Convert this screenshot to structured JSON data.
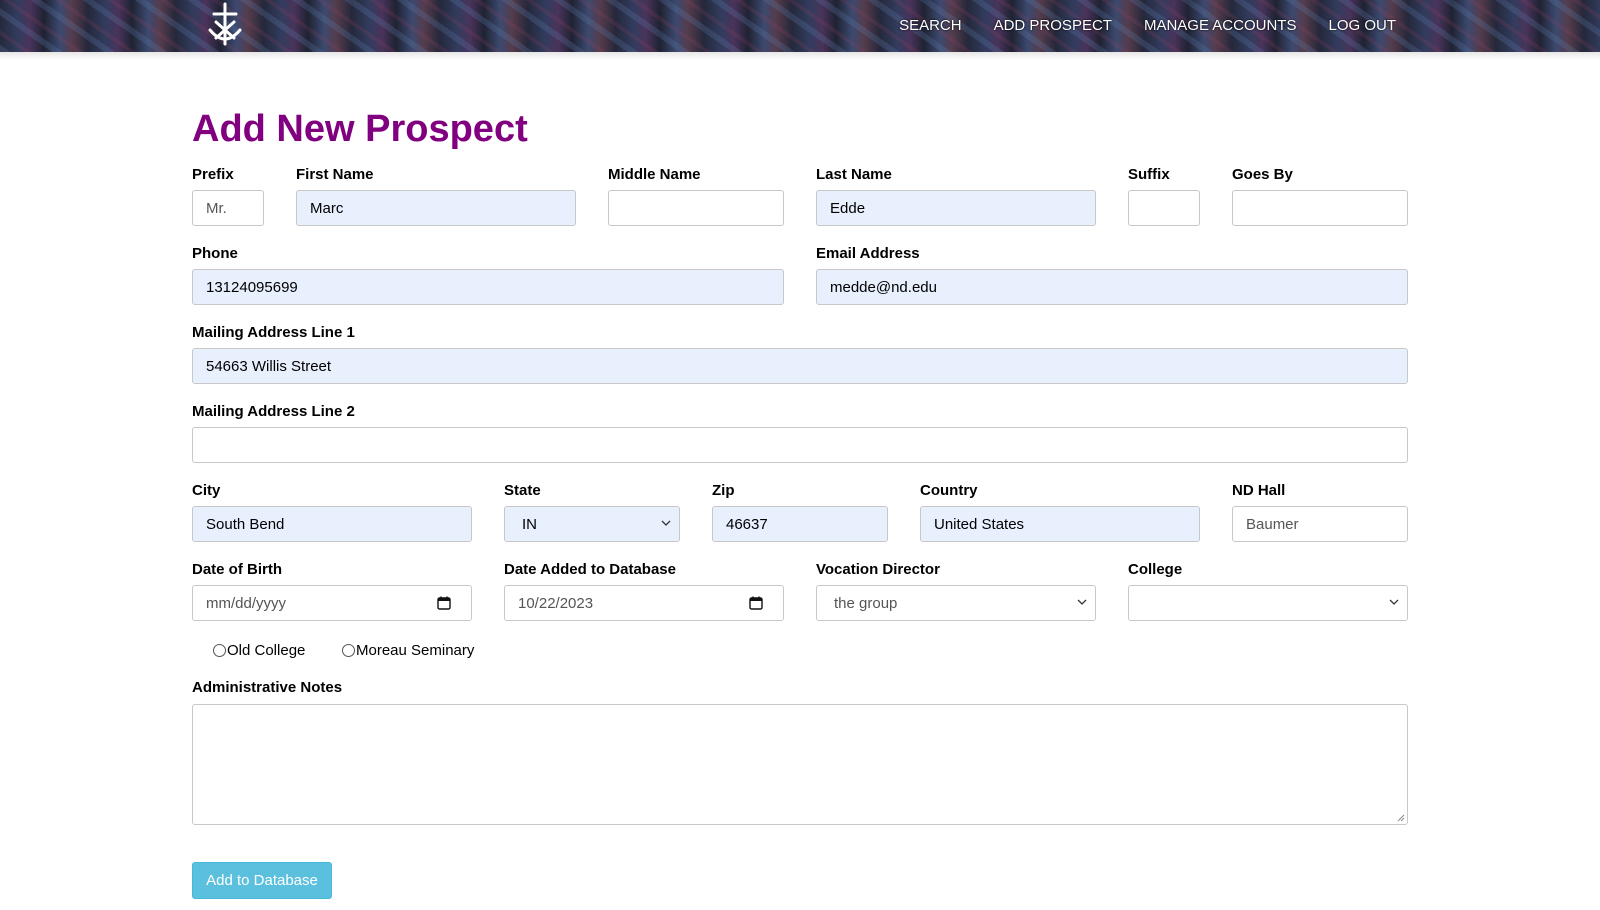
{
  "header": {
    "logo_icon": "cross-anchor-icon",
    "nav": [
      "SEARCH",
      "ADD PROSPECT",
      "MANAGE ACCOUNTS",
      "LOG OUT"
    ]
  },
  "page": {
    "title": "Add New Prospect",
    "title_color": "#800080"
  },
  "form": {
    "prefix": {
      "label": "Prefix",
      "value": "Mr."
    },
    "first_name": {
      "label": "First Name",
      "value": "Marc"
    },
    "middle_name": {
      "label": "Middle Name",
      "value": ""
    },
    "last_name": {
      "label": "Last Name",
      "value": "Edde"
    },
    "suffix": {
      "label": "Suffix",
      "value": ""
    },
    "goes_by": {
      "label": "Goes By",
      "value": ""
    },
    "phone": {
      "label": "Phone",
      "value": "13124095699"
    },
    "email": {
      "label": "Email Address",
      "value": "medde@nd.edu"
    },
    "address1": {
      "label": "Mailing Address Line 1",
      "value": "54663 Willis Street"
    },
    "address2": {
      "label": "Mailing Address Line 2",
      "value": ""
    },
    "city": {
      "label": "City",
      "value": "South Bend"
    },
    "state": {
      "label": "State",
      "value": "IN"
    },
    "zip": {
      "label": "Zip",
      "value": "46637"
    },
    "country": {
      "label": "Country",
      "value": "United States"
    },
    "nd_hall": {
      "label": "ND Hall",
      "value": "Baumer"
    },
    "dob": {
      "label": "Date of Birth",
      "value": "mm/dd/yyyy"
    },
    "date_added": {
      "label": "Date Added to Database",
      "value": "10/22/2023"
    },
    "vocation_director": {
      "label": "Vocation Director",
      "value": "the group"
    },
    "college": {
      "label": "College",
      "value": ""
    },
    "seminary_options": [
      "Old College",
      "Moreau Seminary"
    ],
    "notes": {
      "label": "Administrative Notes",
      "value": ""
    },
    "submit_label": "Add to Database"
  }
}
